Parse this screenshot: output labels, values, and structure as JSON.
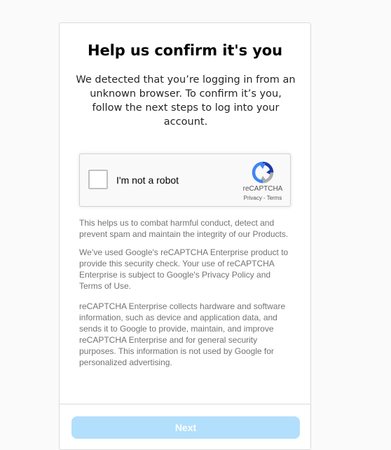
{
  "header": {
    "title": "Help us confirm it's you",
    "subtitle": "We detected that you’re logging in from an unknown browser. To confirm it’s you, follow the next steps to log into your account."
  },
  "recaptcha": {
    "checkbox_label": "I'm not a robot",
    "brand": "reCAPTCHA",
    "privacy_link": "Privacy",
    "separator": "-",
    "terms_link": "Terms",
    "checked": false,
    "logo_icon": "recaptcha-logo-icon",
    "colors": {
      "logo_blue_dark": "#1c3aa9",
      "logo_blue": "#4285f4",
      "logo_gray": "#ababab"
    }
  },
  "info": {
    "paragraph_1": "This helps us to combat harmful conduct, detect and prevent spam and maintain the integrity of our Products.",
    "paragraph_2": "We’ve used Google's reCAPTCHA Enterprise product to provide this security check. Your use of reCAPTCHA Enterprise is subject to Google's Privacy Policy and Terms of Use.",
    "paragraph_3": "reCAPTCHA Enterprise collects hardware and software information, such as device and application data, and sends it to Google to provide, maintain, and improve reCAPTCHA Enterprise and for general security purposes. This information is not used by Google for personalized advertising."
  },
  "footer": {
    "next_label": "Next",
    "next_disabled": true
  },
  "colors": {
    "page_background": "#fafafa",
    "card_border": "#dbdbdb",
    "text_secondary": "#737373",
    "button_disabled_bg": "#b2dffc"
  }
}
